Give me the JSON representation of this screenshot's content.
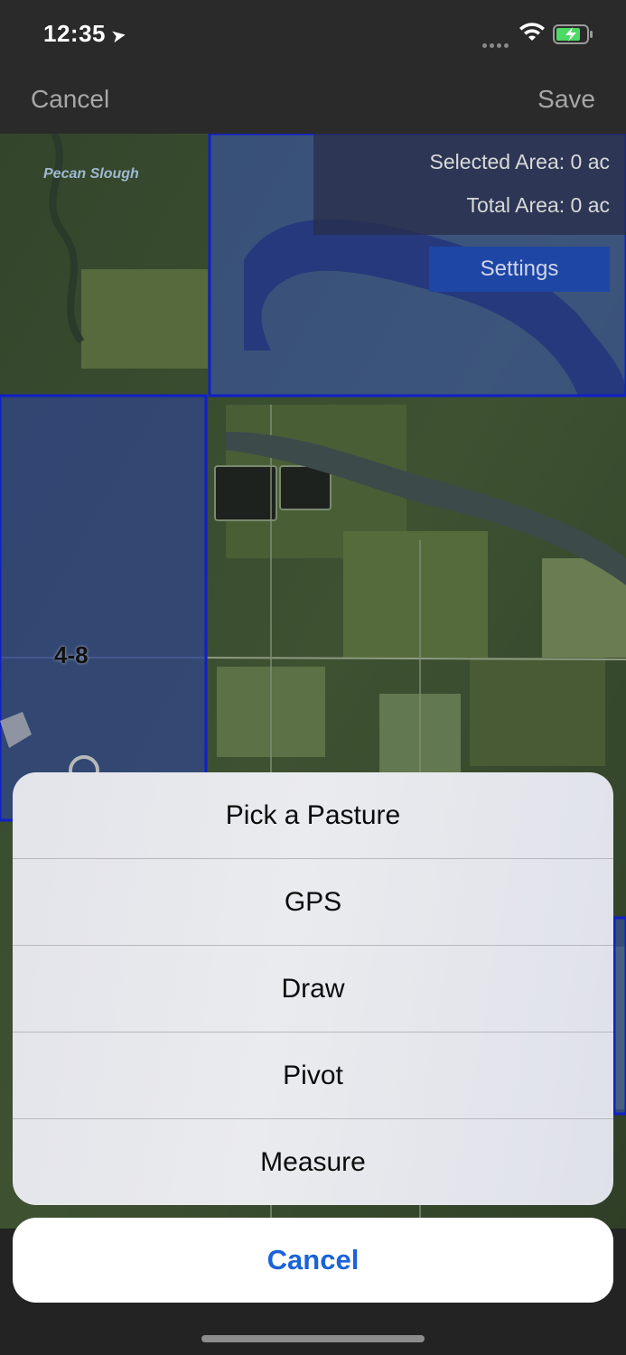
{
  "status_bar": {
    "time": "12:35",
    "location_icon": "location-arrow-icon",
    "wifi_icon": "wifi-icon",
    "battery_icon": "battery-charging-icon"
  },
  "nav": {
    "cancel_label": "Cancel",
    "save_label": "Save"
  },
  "map": {
    "place_label": "Pecan Slough",
    "pasture_label": "4-8",
    "selected_area": "Selected Area: 0 ac",
    "total_area": "Total Area: 0 ac",
    "settings_label": "Settings",
    "colors": {
      "boundary": "#1020c8",
      "selected_fill": "#3a58b8",
      "settings_button": "#1e46a5"
    }
  },
  "action_sheet": {
    "items": [
      {
        "label": "Pick a Pasture"
      },
      {
        "label": "GPS"
      },
      {
        "label": "Draw"
      },
      {
        "label": "Pivot"
      },
      {
        "label": "Measure"
      }
    ],
    "cancel_label": "Cancel",
    "accent": "#1a63d8"
  }
}
